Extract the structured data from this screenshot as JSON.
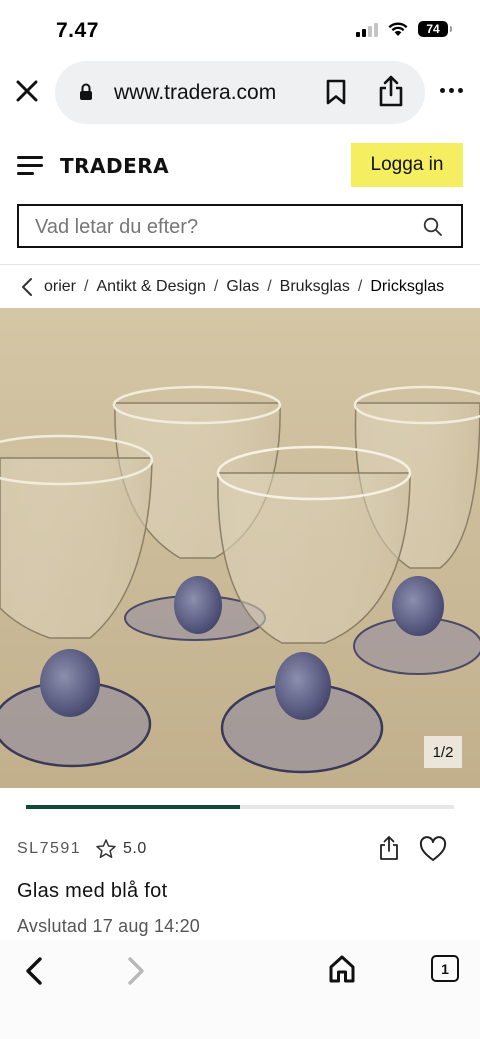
{
  "status": {
    "time": "7.47",
    "battery": "74"
  },
  "browser": {
    "url": "www.tradera.com"
  },
  "header": {
    "logo": "TRADERA",
    "login_label": "Logga in"
  },
  "search": {
    "placeholder": "Vad letar du efter?"
  },
  "breadcrumb": {
    "items": [
      "orier",
      "Antikt & Design",
      "Glas",
      "Bruksglas",
      "Dricksglas"
    ]
  },
  "image": {
    "counter": "1/2",
    "progress": 0.5
  },
  "item": {
    "id": "SL7591",
    "rating": "5.0",
    "title": "Glas med blå fot",
    "ended": "Avslutad 17 aug 14:20"
  },
  "toolbar": {
    "tab_count": "1"
  },
  "colors": {
    "accent_yellow": "#f5ee61",
    "progress_green": "#0e4a35"
  }
}
